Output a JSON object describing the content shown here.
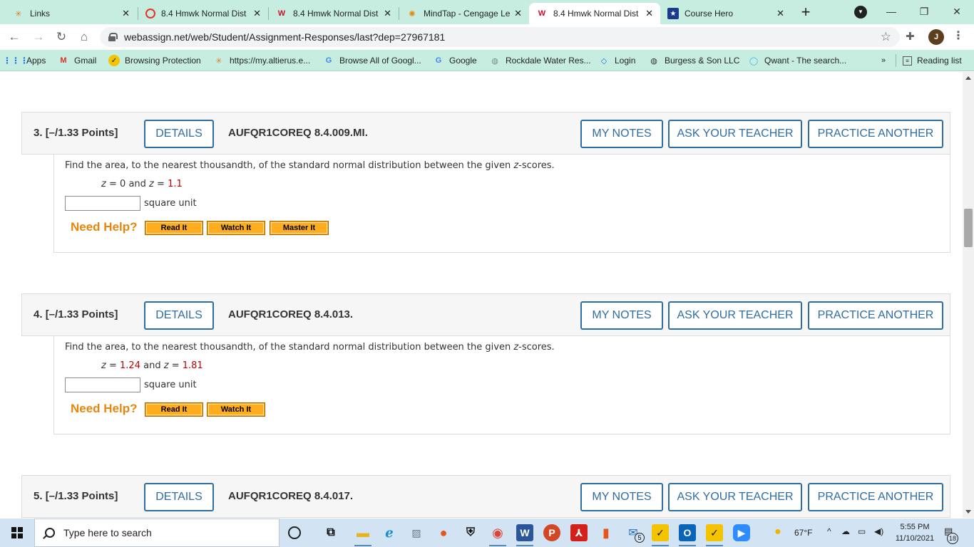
{
  "colors": {
    "chrome_frame": "#c6ede0",
    "accent_blue": "#2e6da4",
    "help_orange": "#e8860c",
    "help_button": "#ffad1f",
    "value_red": "#c00000",
    "taskbar": "#d2e3f4"
  },
  "tabs": [
    {
      "title": "Links",
      "icon": "altierus-icon"
    },
    {
      "title": "8.4 Hmwk Normal Dist",
      "icon": "cengage-ring-icon"
    },
    {
      "title": "8.4 Hmwk Normal Dist",
      "icon": "webassign-icon"
    },
    {
      "title": "MindTap - Cengage Le",
      "icon": "mindtap-icon"
    },
    {
      "title": "8.4 Hmwk Normal Dist",
      "icon": "webassign-icon",
      "active": true
    },
    {
      "title": "Course Hero",
      "icon": "course-hero-icon"
    }
  ],
  "address": {
    "url": "webassign.net/web/Student/Assignment-Responses/last?dep=27967181"
  },
  "profile": {
    "initial": "J"
  },
  "bookmarks": [
    {
      "label": "Apps",
      "icon": "apps-grid-icon"
    },
    {
      "label": "Gmail",
      "icon": "gmail-icon"
    },
    {
      "label": "Browsing Protection",
      "icon": "check-icon"
    },
    {
      "label": "https://my.altierus.e...",
      "icon": "altierus-icon"
    },
    {
      "label": "Browse All of Googl...",
      "icon": "google-icon"
    },
    {
      "label": "Google",
      "icon": "google-icon"
    },
    {
      "label": "Rockdale Water Res...",
      "icon": "globe-icon"
    },
    {
      "label": "Login",
      "icon": "login-icon"
    },
    {
      "label": "Burgess & Son LLC",
      "icon": "globe-icon"
    },
    {
      "label": "Qwant - The search...",
      "icon": "qwant-icon"
    }
  ],
  "bookmarks_more": "»",
  "reading_list": "Reading list",
  "buttons": {
    "details": "DETAILS",
    "my_notes": "MY NOTES",
    "ask_teacher": "ASK YOUR TEACHER",
    "practice": "PRACTICE ANOTHER"
  },
  "help": {
    "need_help": "Need Help?",
    "read_it": "Read It",
    "watch_it": "Watch It",
    "master_it": "Master It"
  },
  "questions": [
    {
      "number": "3.",
      "points": "[–/1.33 Points]",
      "code": "AUFQR1COREQ 8.4.009.MI.",
      "prompt_before": "Find the area, to the nearest thousandth, of the standard normal distribution between the given ",
      "prompt_var": "z",
      "prompt_after": "-scores.",
      "z1": "0",
      "z2": "1.1",
      "answer": "",
      "unit": "square unit"
    },
    {
      "number": "4.",
      "points": "[–/1.33 Points]",
      "code": "AUFQR1COREQ 8.4.013.",
      "prompt_before": "Find the area, to the nearest thousandth, of the standard normal distribution between the given ",
      "prompt_var": "z",
      "prompt_after": "-scores.",
      "z1": "1.24",
      "z2": "1.81",
      "answer": "",
      "unit": "square unit"
    },
    {
      "number": "5.",
      "points": "[–/1.33 Points]",
      "code": "AUFQR1COREQ 8.4.017."
    }
  ],
  "eq": {
    "var": "z",
    "equals": "=",
    "and": "and"
  },
  "taskbar": {
    "search_placeholder": "Type here to search",
    "weather": "67°F",
    "time": "5:55 PM",
    "date": "11/10/2021",
    "notifications": "18",
    "mail_badge": "5"
  }
}
